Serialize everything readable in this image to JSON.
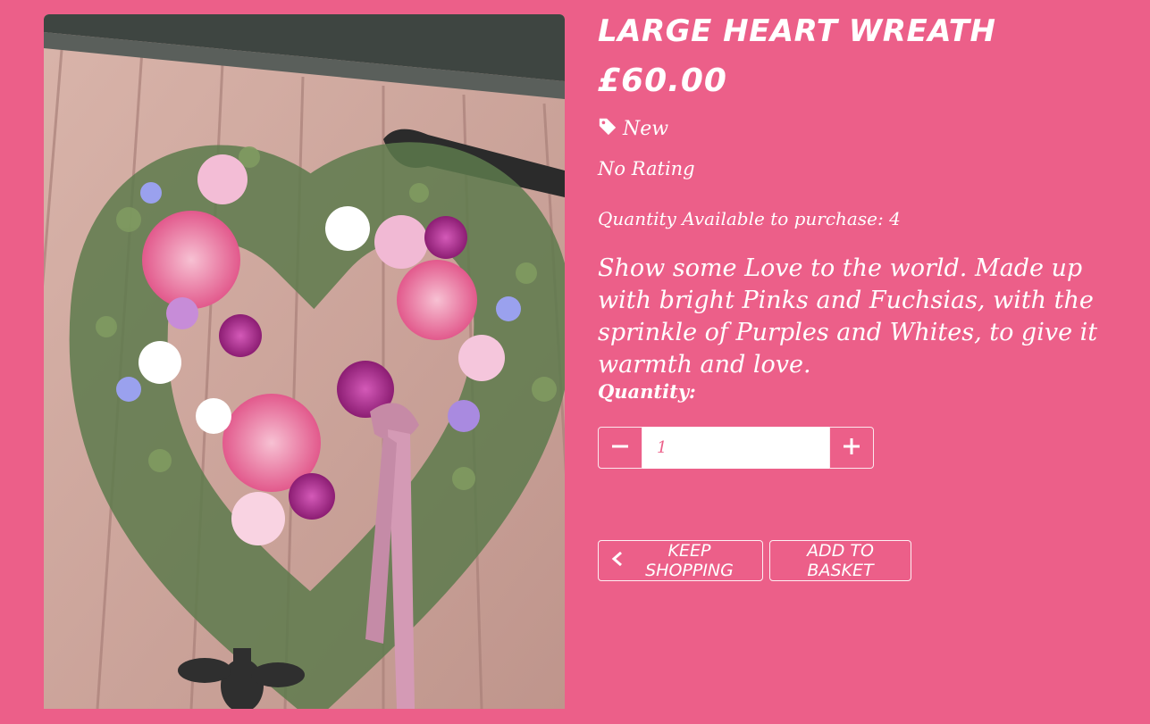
{
  "product": {
    "title": "LARGE HEART WREATH",
    "price": "£60.00",
    "tag": "New",
    "rating": "No Rating",
    "availability_label": "Quantity Available to purchase:",
    "availability_value": "4",
    "description": "Show some Love to the world. Made up with bright Pinks and Fuchsias, with the sprinkle of Purples and Whites, to give it warmth and love."
  },
  "quantity": {
    "label": "Quantity:",
    "value": "1"
  },
  "actions": {
    "keep_shopping": "KEEP SHOPPING",
    "add_to_basket": "ADD TO BASKET"
  },
  "icons": {
    "tag": "tag-icon",
    "minus": "minus-icon",
    "plus": "plus-icon",
    "back": "chevron-left-icon"
  },
  "colors": {
    "background": "#ec5f89",
    "text": "#ffffff"
  }
}
